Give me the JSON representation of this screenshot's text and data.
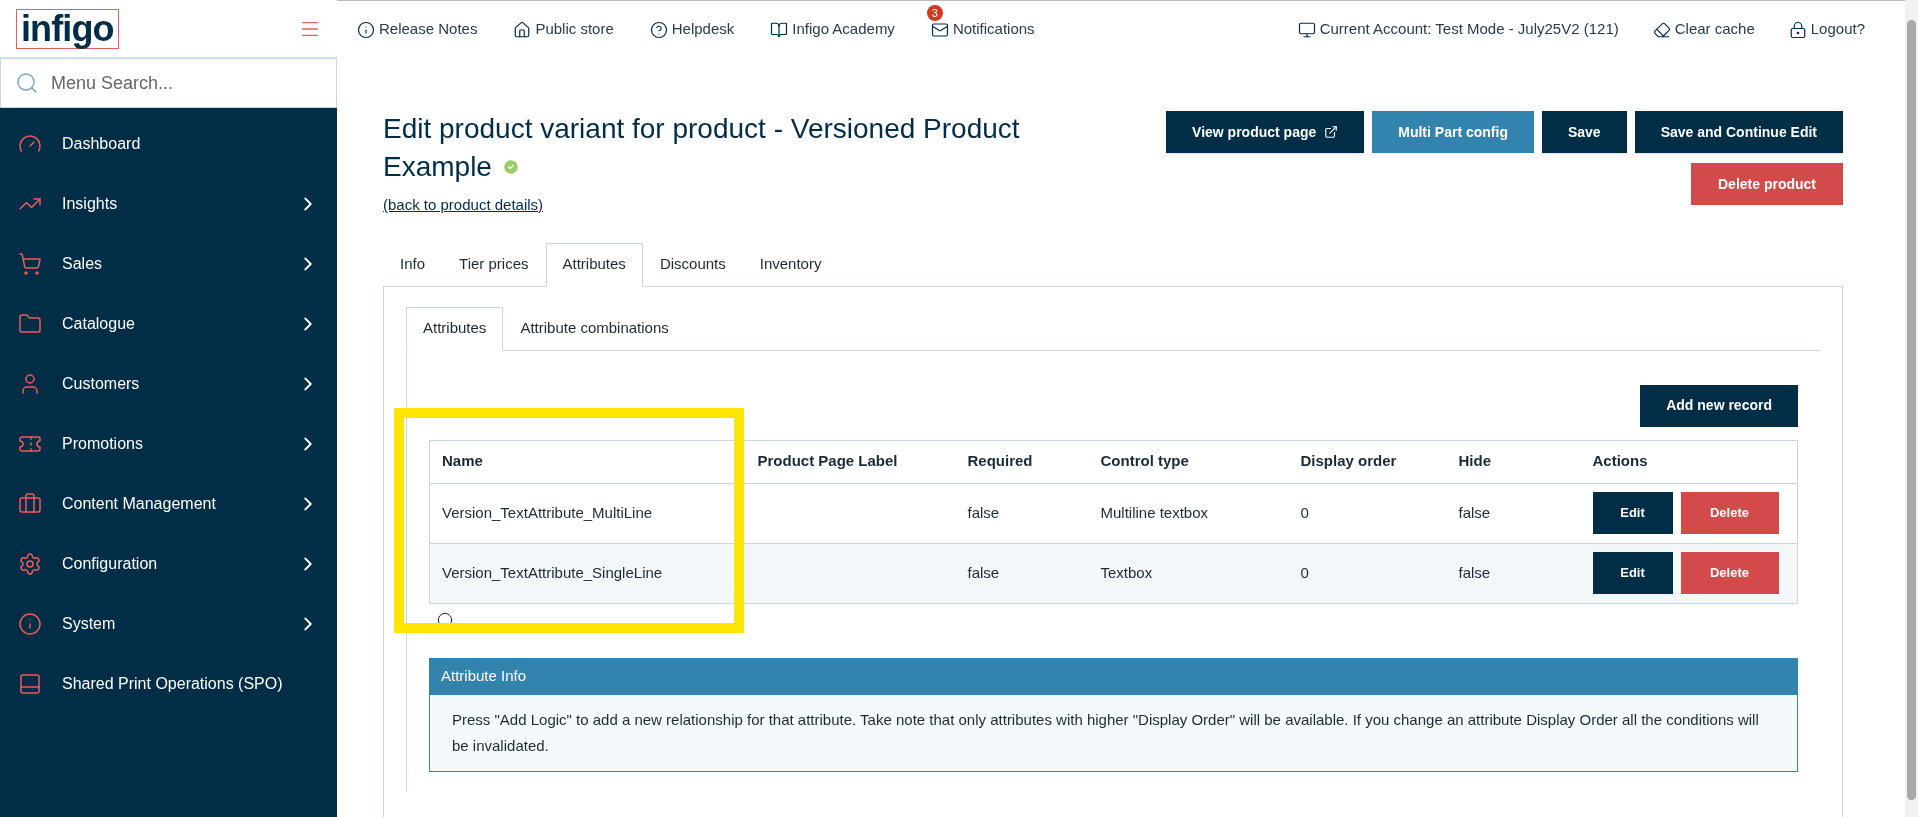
{
  "logo": {
    "text": "infigo"
  },
  "sidebar": {
    "search": {
      "placeholder": "Menu Search..."
    },
    "items": [
      {
        "label": "Dashboard",
        "has_children": false
      },
      {
        "label": "Insights",
        "has_children": true
      },
      {
        "label": "Sales",
        "has_children": true
      },
      {
        "label": "Catalogue",
        "has_children": true
      },
      {
        "label": "Customers",
        "has_children": true
      },
      {
        "label": "Promotions",
        "has_children": true
      },
      {
        "label": "Content Management",
        "has_children": true
      },
      {
        "label": "Configuration",
        "has_children": true
      },
      {
        "label": "System",
        "has_children": true
      },
      {
        "label": "Shared Print Operations (SPO)",
        "has_children": false
      }
    ]
  },
  "topbar": {
    "left": [
      {
        "label": "Release Notes"
      },
      {
        "label": "Public store"
      },
      {
        "label": "Helpdesk"
      },
      {
        "label": "Infigo Academy"
      },
      {
        "label": "Notifications",
        "badge": "3"
      }
    ],
    "right": [
      {
        "label": "Current Account: Test Mode - July25V2 (121)"
      },
      {
        "label": "Clear cache"
      },
      {
        "label": "Logout?"
      }
    ]
  },
  "page": {
    "title": "Edit product variant for product - Versioned Product Example",
    "verified": true,
    "back_link": "(back to product details)",
    "buttons": [
      {
        "label": "View product page",
        "kind": "dark",
        "external": true
      },
      {
        "label": "Multi Part config",
        "kind": "blue",
        "external": false
      },
      {
        "label": "Save",
        "kind": "dark",
        "external": false
      },
      {
        "label": "Save and Continue Edit",
        "kind": "dark",
        "external": false
      },
      {
        "label": "Delete product",
        "kind": "red",
        "external": false
      }
    ],
    "tabs": [
      {
        "label": "Info",
        "selected": false
      },
      {
        "label": "Tier prices",
        "selected": false
      },
      {
        "label": "Attributes",
        "selected": true
      },
      {
        "label": "Discounts",
        "selected": false
      },
      {
        "label": "Inventory",
        "selected": false
      }
    ],
    "subtabs": [
      {
        "label": "Attributes",
        "selected": true
      },
      {
        "label": "Attribute combinations",
        "selected": false
      }
    ],
    "add_button": "Add new record",
    "table": {
      "columns": [
        "Name",
        "Product Page Label",
        "Required",
        "Control type",
        "Display order",
        "Hide",
        "Actions"
      ],
      "rows": [
        {
          "name": "Version_TextAttribute_MultiLine",
          "required": "false",
          "control_type": "Multiline textbox",
          "display_order": "0",
          "hide": "false",
          "edit": "Edit",
          "delete": "Delete"
        },
        {
          "name": "Version_TextAttribute_SingleLine",
          "required": "false",
          "control_type": "Textbox",
          "display_order": "0",
          "hide": "false",
          "edit": "Edit",
          "delete": "Delete"
        }
      ]
    },
    "info_box": {
      "title": "Attribute Info",
      "text": "Press \"Add Logic\" to add a new relationship for that attribute. Take note that only attributes with higher \"Display Order\" will be available. If you change an attribute Display Order all the conditions will be invalidated."
    }
  }
}
